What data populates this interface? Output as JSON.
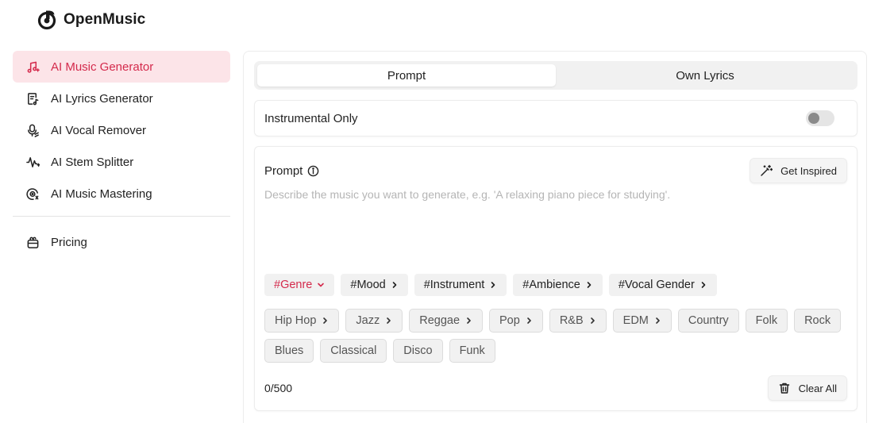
{
  "app": {
    "name": "OpenMusic"
  },
  "sidebar": {
    "items": [
      {
        "label": "AI Music Generator",
        "icon": "music-note-icon",
        "active": true
      },
      {
        "label": "AI Lyrics Generator",
        "icon": "lyrics-doc-icon",
        "active": false
      },
      {
        "label": "AI Vocal Remover",
        "icon": "microphone-icon",
        "active": false
      },
      {
        "label": "AI Stem Splitter",
        "icon": "waveform-icon",
        "active": false
      },
      {
        "label": "AI Music Mastering",
        "icon": "disc-icon",
        "active": false
      }
    ],
    "pricing": {
      "label": "Pricing",
      "icon": "basket-icon"
    }
  },
  "tabs": [
    {
      "label": "Prompt",
      "active": true
    },
    {
      "label": "Own Lyrics",
      "active": false
    }
  ],
  "instrumental": {
    "label": "Instrumental Only",
    "enabled": false
  },
  "prompt": {
    "title": "Prompt",
    "placeholder": "Describe the music you want to generate, e.g. 'A relaxing piano piece for studying'.",
    "value": "",
    "get_inspired_label": "Get Inspired",
    "char_count": "0/500",
    "clear_all_label": "Clear All",
    "categories": [
      {
        "label": "#Genre",
        "active": true
      },
      {
        "label": "#Mood",
        "active": false
      },
      {
        "label": "#Instrument",
        "active": false
      },
      {
        "label": "#Ambience",
        "active": false
      },
      {
        "label": "#Vocal Gender",
        "active": false
      }
    ],
    "tags": [
      {
        "label": "Hip Hop",
        "has_sub": true
      },
      {
        "label": "Jazz",
        "has_sub": true
      },
      {
        "label": "Reggae",
        "has_sub": true
      },
      {
        "label": "Pop",
        "has_sub": true
      },
      {
        "label": "R&B",
        "has_sub": true
      },
      {
        "label": "EDM",
        "has_sub": true
      },
      {
        "label": "Country",
        "has_sub": false
      },
      {
        "label": "Folk",
        "has_sub": false
      },
      {
        "label": "Rock",
        "has_sub": false
      },
      {
        "label": "Blues",
        "has_sub": false
      },
      {
        "label": "Classical",
        "has_sub": false
      },
      {
        "label": "Disco",
        "has_sub": false
      },
      {
        "label": "Funk",
        "has_sub": false
      }
    ]
  },
  "colors": {
    "accent": "#d42a4c",
    "accent_bg": "#fce4e8",
    "chip_bg": "#f1f1f1",
    "border": "#ececec"
  }
}
